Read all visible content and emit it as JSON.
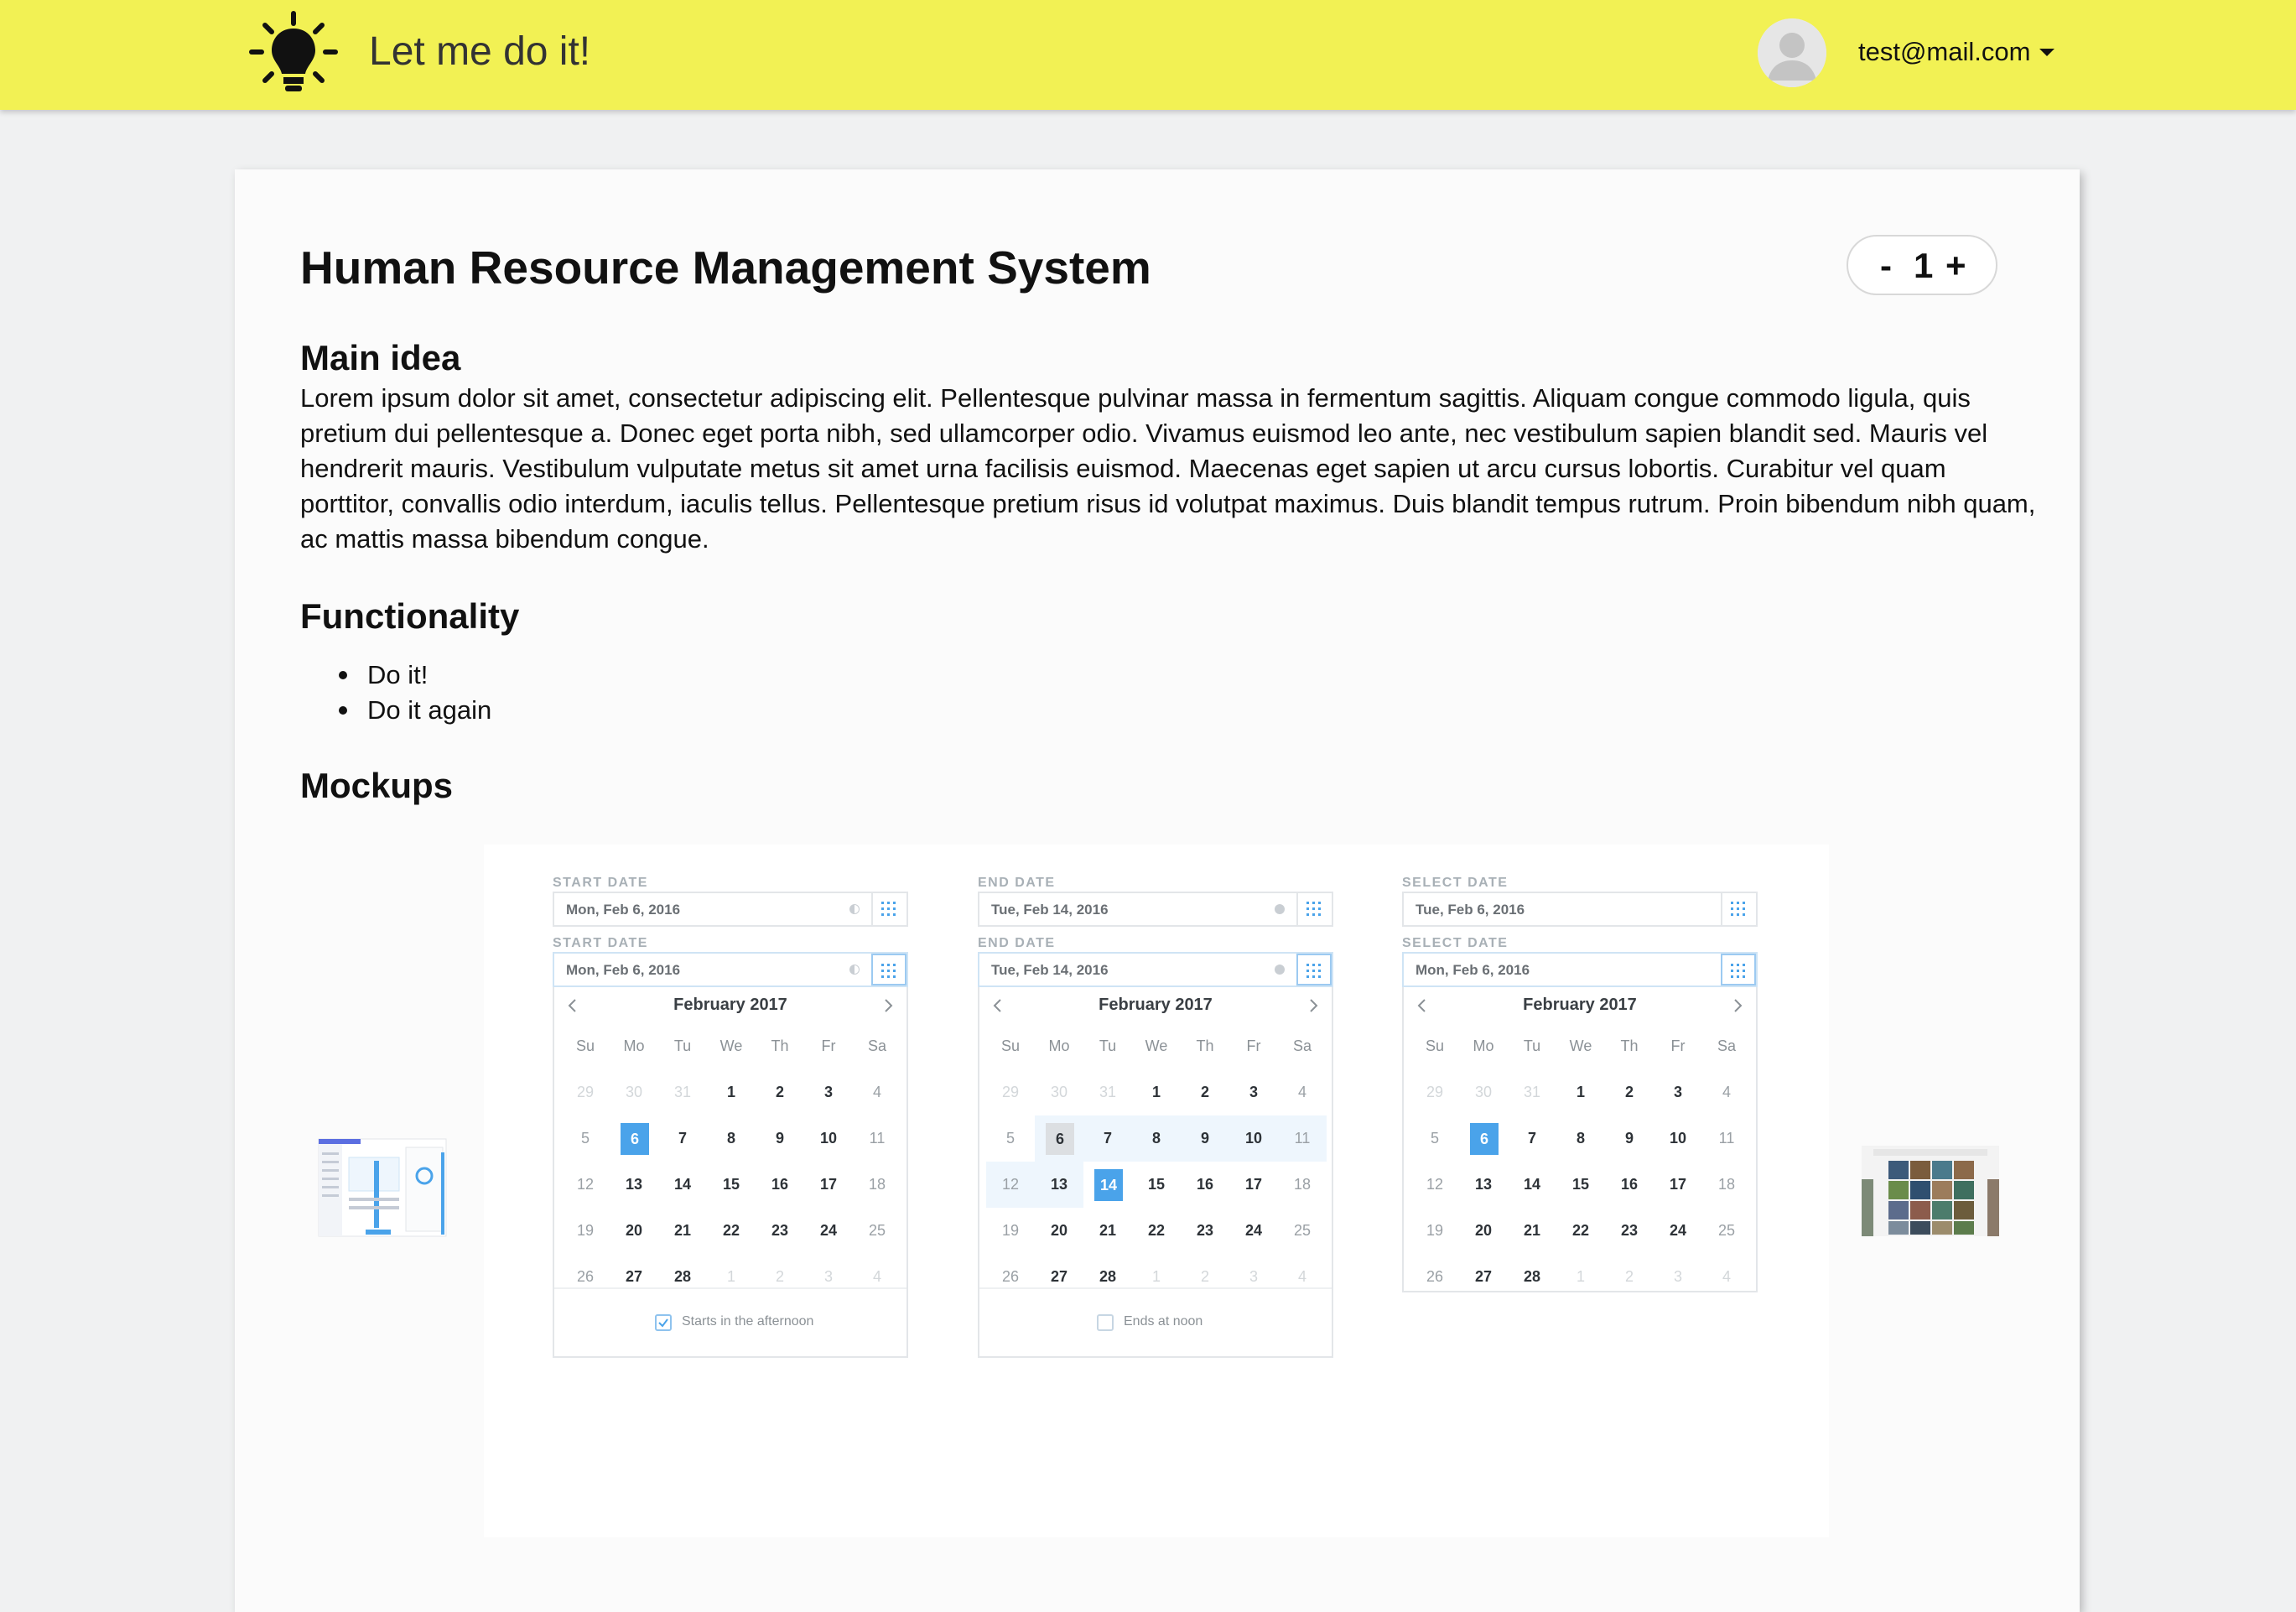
{
  "header": {
    "app_title": "Let me do it!",
    "user_email": "test@mail.com",
    "background_color": "#f2f154"
  },
  "project": {
    "title": "Human Resource Management System",
    "vote_minus": "-",
    "vote_count": "1",
    "vote_plus": "+"
  },
  "sections": {
    "main_idea_heading": "Main idea",
    "main_idea_text": "Lorem ipsum dolor sit amet, consectetur adipiscing elit. Pellentesque pulvinar massa in fermentum sagittis. Aliquam congue commodo ligula, quis pretium dui pellentesque a. Donec eget porta nibh, sed ullamcorper odio. Vivamus euismod leo ante, nec vestibulum sapien blandit sed. Mauris vel hendrerit mauris. Vestibulum vulputate metus sit amet urna facilisis euismod. Maecenas eget sapien ut arcu cursus lobortis. Curabitur vel quam porttitor, convallis odio interdum, iaculis tellus. Pellentesque pretium risus id volutpat maximus. Duis blandit tempus rutrum. Proin bibendum nibh quam, ac mattis massa bibendum congue.",
    "functionality_heading": "Functionality",
    "functionality_items": [
      "Do it!",
      "Do it again"
    ],
    "mockups_heading": "Mockups"
  },
  "mockup": {
    "columns": [
      {
        "label": "START DATE",
        "value": "Mon, Feb 6, 2016",
        "month": "February 2017",
        "footer_label": "Starts in the afternoon",
        "footer_checked": true
      },
      {
        "label": "END DATE",
        "value": "Tue, Feb 14, 2016",
        "month": "February 2017",
        "footer_label": "Ends at noon",
        "footer_checked": false
      },
      {
        "label": "SELECT DATE",
        "value": "Tue, Feb 6, 2016",
        "month": "February 2017",
        "footer_label": "",
        "footer_checked": false
      }
    ],
    "second_row_values": [
      "Mon, Feb 6, 2016",
      "Tue, Feb 14, 2016",
      "Mon, Feb 6, 2016"
    ],
    "weekdays": [
      "Su",
      "Mo",
      "Tu",
      "We",
      "Th",
      "Fr",
      "Sa"
    ],
    "weeks": [
      [
        "29",
        "30",
        "31",
        "1",
        "2",
        "3",
        "4"
      ],
      [
        "5",
        "6",
        "7",
        "8",
        "9",
        "10",
        "11"
      ],
      [
        "12",
        "13",
        "14",
        "15",
        "16",
        "17",
        "18"
      ],
      [
        "19",
        "20",
        "21",
        "22",
        "23",
        "24",
        "25"
      ],
      [
        "26",
        "27",
        "28",
        "1",
        "2",
        "3",
        "4"
      ]
    ],
    "accent_color": "#4aa3ea"
  }
}
